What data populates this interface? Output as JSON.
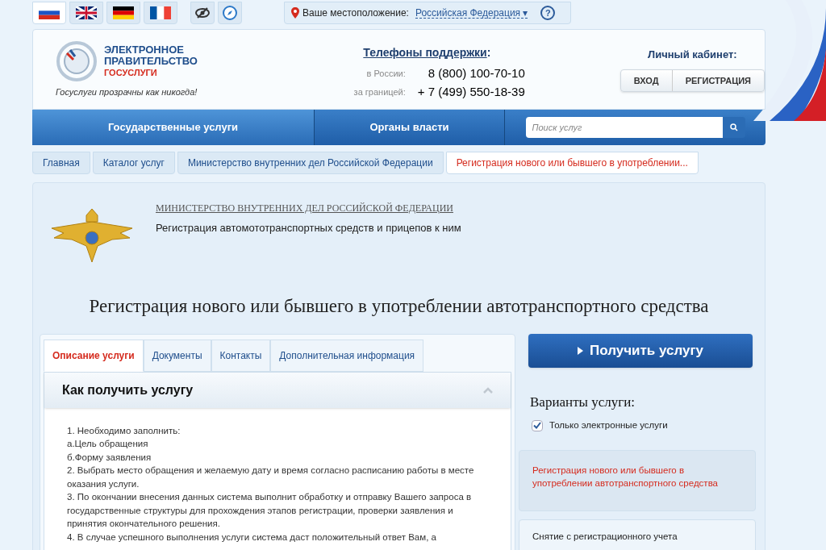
{
  "languages": [
    {
      "kind": "ru",
      "selected": true
    },
    {
      "kind": "gb",
      "selected": false
    },
    {
      "kind": "de",
      "selected": false
    },
    {
      "kind": "fr",
      "selected": false
    }
  ],
  "location": {
    "label": "Ваше местоположение:",
    "value": "Российская Федерация",
    "caret": "▾",
    "help": "?"
  },
  "logo": {
    "line1": "ЭЛЕКТРОННОЕ",
    "line2": "ПРАВИТЕЛЬСТВО",
    "line3": "ГОСУСЛУГИ",
    "slogan": "Госуслуги прозрачны как никогда!"
  },
  "support": {
    "title": "Телефоны поддержки",
    "colon": ":",
    "phones": [
      {
        "label": "в России:",
        "number": "8 (800) 100-70-10"
      },
      {
        "label": "за границей:",
        "number": "+ 7 (499) 550-18-39"
      }
    ]
  },
  "account": {
    "title": "Личный кабинет:",
    "buttons": [
      "ВХОД",
      "РЕГИСТРАЦИЯ"
    ]
  },
  "nav": [
    {
      "label": "Государственные услуги",
      "selected": true
    },
    {
      "label": "Органы власти",
      "selected": false
    }
  ],
  "search": {
    "placeholder": "Поиск услуг"
  },
  "breadcrumbs": [
    {
      "label": "Главная",
      "selected": false
    },
    {
      "label": "Каталог услуг",
      "selected": false
    },
    {
      "label": "Министерство внутренних дел Российской Федерации",
      "selected": false
    },
    {
      "label": "Регистрация нового или бывшего в употреблении...",
      "selected": true
    }
  ],
  "agency": {
    "name": "МИНИСТЕРСТВО ВНУТРЕННИХ ДЕЛ РОССИЙСКОЙ ФЕДЕРАЦИИ",
    "category": "Регистрация автомототранспортных средств и прицепов к ним"
  },
  "page_title": "Регистрация нового или бывшего в употреблении автотранспортного средства",
  "tabs": [
    {
      "label": "Описание услуги",
      "selected": true
    },
    {
      "label": "Документы",
      "selected": false
    },
    {
      "label": "Контакты",
      "selected": false
    },
    {
      "label": "Дополнительная информация",
      "selected": false
    }
  ],
  "section": {
    "title": "Как получить услугу",
    "expanded": true,
    "lines": [
      "1. Необходимо заполнить:",
      "а.Цель обращения",
      "б.Форму заявления",
      "2. Выбрать место обращения и желаемую дату и время согласно расписанию работы в месте оказания услуги.",
      "3. По окончании внесения данных система выполнит обработку и отправку Вашего запроса в государственные структуры для прохождения этапов регистрации, проверки заявления и принятия окончательного решения.",
      "4. В случае успешного выполнения услуги система даст положительный ответ Вам, а"
    ]
  },
  "get_service": "Получить услугу",
  "variants": {
    "title": "Варианты услуги:",
    "filter": {
      "label": "Только электронные услуги",
      "checked": true
    },
    "items": [
      {
        "label": "Регистрация нового или бывшего в употреблении автотранспортного средства",
        "selected": true
      },
      {
        "label": "Снятие с регистрационного учета",
        "selected": false
      }
    ]
  }
}
